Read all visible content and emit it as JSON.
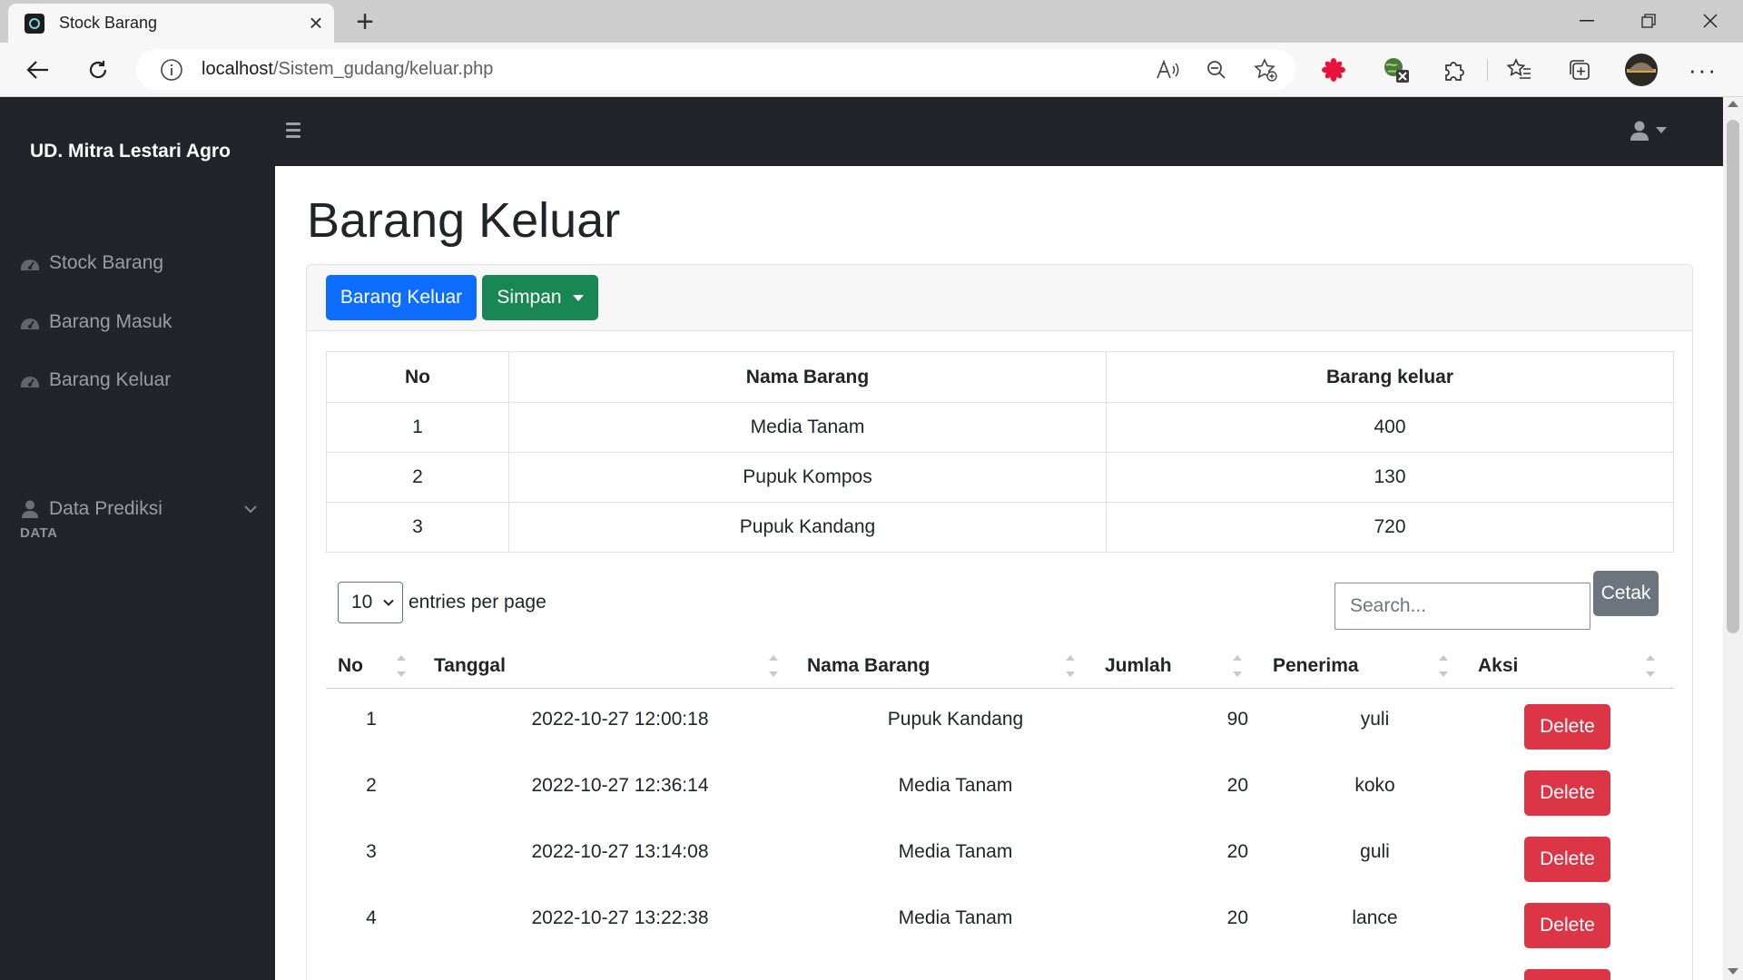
{
  "browser": {
    "tab_title": "Stock Barang",
    "url_host": "localhost",
    "url_path": "/Sistem_gudang/keluar.php"
  },
  "sidebar": {
    "brand": "UD. Mitra Lestari Agro",
    "items": [
      {
        "label": "Stock Barang",
        "icon": "tachometer-icon"
      },
      {
        "label": "Barang Masuk",
        "icon": "tachometer-icon"
      },
      {
        "label": "Barang Keluar",
        "icon": "tachometer-icon"
      }
    ],
    "heading": "DATA",
    "data_item": {
      "label": "Data Prediksi",
      "icon": "user-icon"
    }
  },
  "main": {
    "title": "Barang Keluar",
    "btn_keluar": "Barang Keluar",
    "btn_simpan": "Simpan",
    "summary": {
      "headers": [
        "No",
        "Nama Barang",
        "Barang keluar"
      ],
      "rows": [
        [
          "1",
          "Media Tanam",
          "400"
        ],
        [
          "2",
          "Pupuk Kompos",
          "130"
        ],
        [
          "3",
          "Pupuk Kandang",
          "720"
        ]
      ]
    },
    "entries_value": "10",
    "entries_label": "entries per page",
    "search_placeholder": "Search...",
    "btn_cetak": "Cetak",
    "table": {
      "headers": [
        "No",
        "Tanggal",
        "Nama Barang",
        "Jumlah",
        "Penerima",
        "Aksi"
      ],
      "rows": [
        [
          "1",
          "2022-10-27 12:00:18",
          "Pupuk Kandang",
          "90",
          "yuli"
        ],
        [
          "2",
          "2022-10-27 12:36:14",
          "Media Tanam",
          "20",
          "koko"
        ],
        [
          "3",
          "2022-10-27 13:14:08",
          "Media Tanam",
          "20",
          "guli"
        ],
        [
          "4",
          "2022-10-27 13:22:38",
          "Media Tanam",
          "20",
          "lance"
        ]
      ],
      "delete_label": "Delete"
    }
  }
}
